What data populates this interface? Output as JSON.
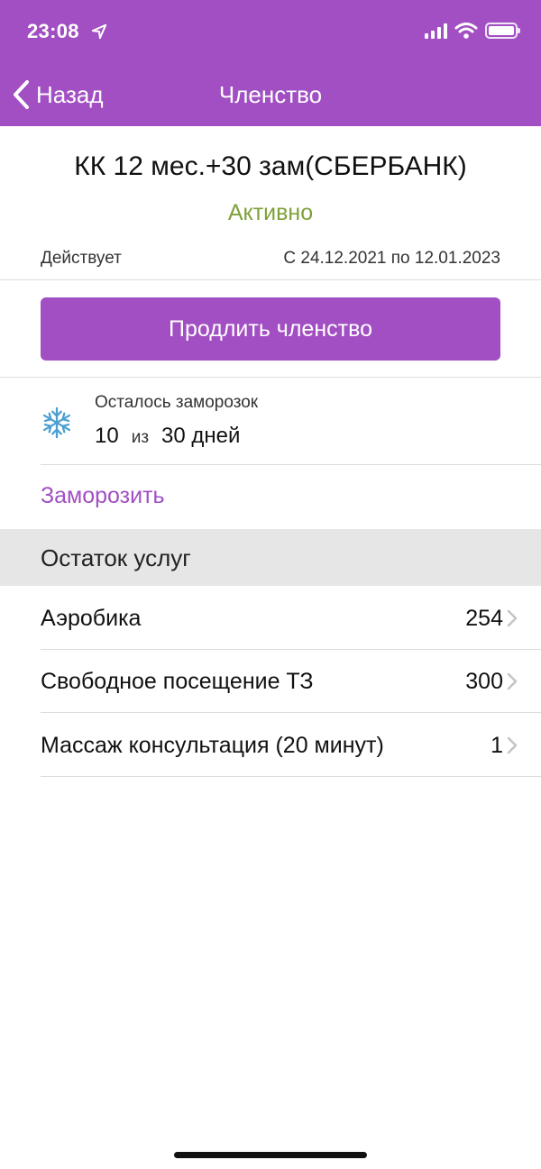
{
  "status_bar": {
    "time": "23:08"
  },
  "nav": {
    "back_label": "Назад",
    "title": "Членство"
  },
  "membership": {
    "plan_name": "КК 12 мес.+30 зам(СБЕРБАНК)",
    "status": "Активно",
    "validity_label": "Действует",
    "validity_value": "С 24.12.2021 по 12.01.2023",
    "extend_button": "Продлить членство"
  },
  "freeze": {
    "caption": "Осталось заморозок",
    "remaining": "10",
    "of_label": "из",
    "total": "30 дней",
    "action_label": "Заморозить"
  },
  "services": {
    "header": "Остаток услуг",
    "items": [
      {
        "name": "Аэробика",
        "count": "254"
      },
      {
        "name": "Свободное посещение ТЗ",
        "count": "300"
      },
      {
        "name": "Массаж консультация (20 минут)",
        "count": "1"
      }
    ]
  },
  "colors": {
    "accent": "#a14fc2",
    "active_status": "#7fa13a",
    "section_bg": "#e6e6e6",
    "snowflake": "#4a9fd0"
  },
  "icons": {
    "back": "chevron-left-icon",
    "freeze": "snowflake-icon",
    "row": "chevron-right-icon",
    "location": "location-arrow-icon"
  }
}
